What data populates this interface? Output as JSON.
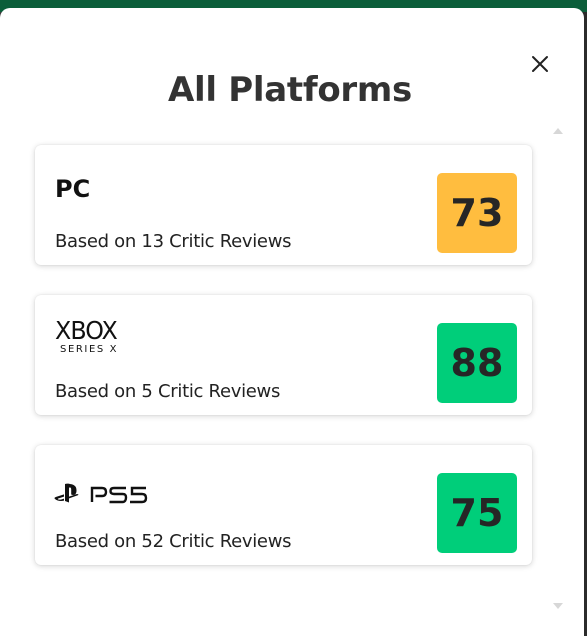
{
  "modal": {
    "title": "All Platforms",
    "close_icon": "close-icon"
  },
  "platforms": [
    {
      "name": "PC",
      "reviews_text": "Based on 13 Critic Reviews",
      "score": "73",
      "score_color": "#ffbd3f"
    },
    {
      "name": "XBOX",
      "logo_subtext": "SERIES X",
      "reviews_text": "Based on 5 Critic Reviews",
      "score": "88",
      "score_color": "#00ce7a"
    },
    {
      "name": "PS5",
      "logo_icon": "playstation-icon",
      "reviews_text": "Based on 52 Critic Reviews",
      "score": "75",
      "score_color": "#00ce7a"
    }
  ]
}
